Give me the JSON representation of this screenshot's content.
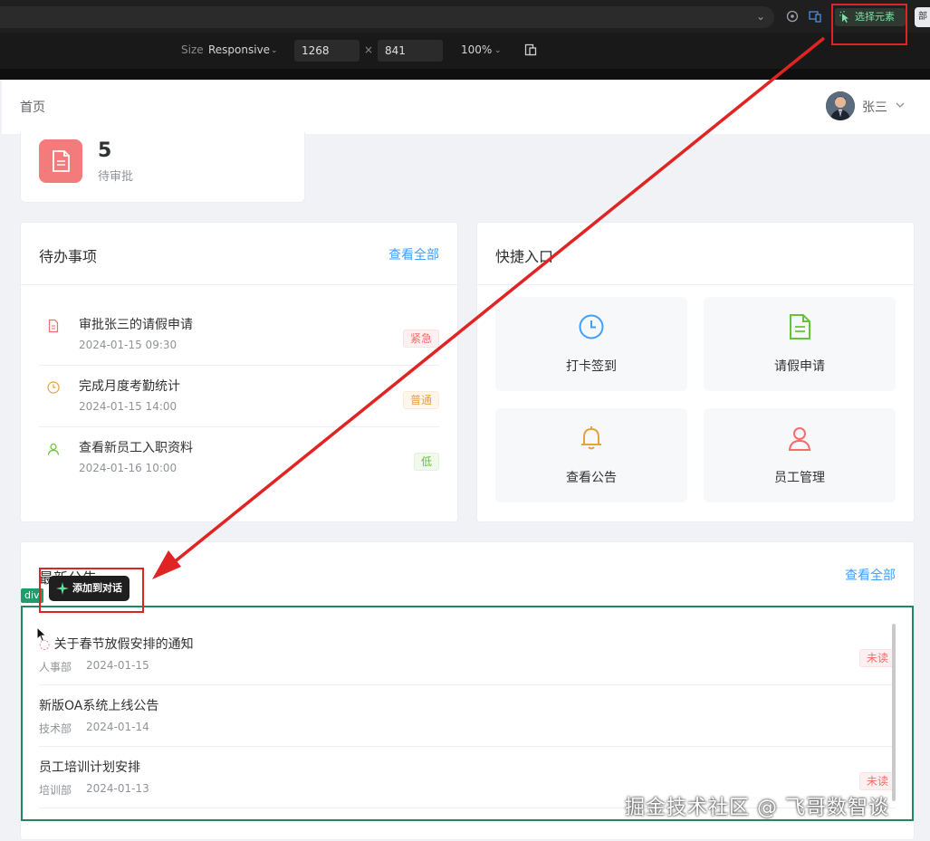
{
  "devtools": {
    "pick_element_label": "选择元素",
    "size_label": "Size",
    "size_value": "Responsive",
    "width": "1268",
    "times": "×",
    "height": "841",
    "zoom": "100%",
    "edge_label": "部"
  },
  "header": {
    "breadcrumb": "首页",
    "user_name": "张三"
  },
  "stat": {
    "value": "5",
    "label": "待审批"
  },
  "todo": {
    "title": "待办事项",
    "view_all": "查看全部",
    "items": [
      {
        "title": "审批张三的请假申请",
        "time": "2024-01-15 09:30",
        "tag": "紧急"
      },
      {
        "title": "完成月度考勤统计",
        "time": "2024-01-15 14:00",
        "tag": "普通"
      },
      {
        "title": "查看新员工入职资料",
        "time": "2024-01-16 10:00",
        "tag": "低"
      }
    ]
  },
  "quick": {
    "title": "快捷入口",
    "items": [
      {
        "label": "打卡签到",
        "icon": "clock-icon"
      },
      {
        "label": "请假申请",
        "icon": "document-icon"
      },
      {
        "label": "查看公告",
        "icon": "bell-icon"
      },
      {
        "label": "员工管理",
        "icon": "user-icon"
      }
    ]
  },
  "notice": {
    "title": "最新公告",
    "view_all": "查看全部",
    "items": [
      {
        "title": "关于春节放假安排的通知",
        "dept": "人事部",
        "date": "2024-01-15",
        "tag": "未读"
      },
      {
        "title": "新版OA系统上线公告",
        "dept": "技术部",
        "date": "2024-01-14",
        "tag": ""
      },
      {
        "title": "员工培训计划安排",
        "dept": "培训部",
        "date": "2024-01-13",
        "tag": "未读"
      }
    ]
  },
  "overlay": {
    "element_badge": "div",
    "add_to_chat": "添加到对话",
    "watermark": "掘金技术社区 @ 飞哥数智谈"
  },
  "colors": {
    "accent": "#409eff",
    "danger": "#f56c6c",
    "warning": "#e6a23c",
    "success": "#67c23a",
    "selection": "#1f8a5d",
    "annotation": "#e02424"
  }
}
